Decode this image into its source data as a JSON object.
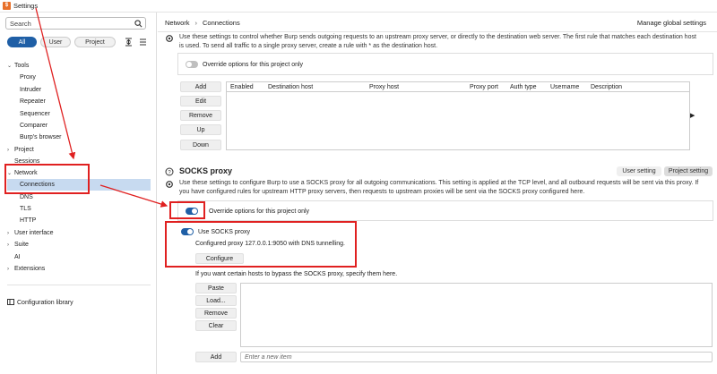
{
  "window": {
    "title": "Settings"
  },
  "sidebar": {
    "search_placeholder": "Search",
    "filters": {
      "all": "All",
      "user": "User",
      "project": "Project"
    },
    "tree": {
      "tools": "Tools",
      "proxy": "Proxy",
      "intruder": "Intruder",
      "repeater": "Repeater",
      "sequencer": "Sequencer",
      "comparer": "Comparer",
      "burps_browser": "Burp's browser",
      "project": "Project",
      "sessions": "Sessions",
      "network": "Network",
      "connections": "Connections",
      "dns": "DNS",
      "tls": "TLS",
      "http": "HTTP",
      "user_interface": "User interface",
      "suite": "Suite",
      "ai": "AI",
      "extensions": "Extensions",
      "config_library": "Configuration library"
    }
  },
  "header": {
    "breadcrumb": [
      "Network",
      "Connections"
    ],
    "manage": "Manage global settings"
  },
  "upstream": {
    "desc1": "Use these settings to control whether Burp sends outgoing requests to an upstream proxy server, or directly to the destination web server. The first rule that matches each destination host",
    "desc2": "is used. To send all traffic to a single proxy server, create a rule with * as the destination host.",
    "override": "Override options for this project only",
    "buttons": {
      "add": "Add",
      "edit": "Edit",
      "remove": "Remove",
      "up": "Up",
      "down": "Down"
    },
    "columns": [
      "Enabled",
      "Destination host",
      "Proxy host",
      "Proxy port",
      "Auth type",
      "Username",
      "Description"
    ]
  },
  "socks": {
    "title": "SOCKS proxy",
    "tag_user": "User setting",
    "tag_project": "Project setting",
    "desc1": "Use these settings to configure Burp to use a SOCKS proxy for all outgoing communications. This setting is applied at the TCP level, and all outbound requests will be sent via this proxy. If",
    "desc2": "you have configured rules for upstream HTTP proxy servers, then requests to upstream proxies will be sent via the SOCKS proxy configured here.",
    "override": "Override options for this project only",
    "use_socks": "Use SOCKS proxy",
    "configured": "Configured proxy 127.0.0.1:9050 with DNS tunnelling.",
    "configure": "Configure",
    "bypass_desc": "If you want certain hosts to bypass the SOCKS proxy, specify them here.",
    "buttons": {
      "paste": "Paste",
      "load": "Load...",
      "remove": "Remove",
      "clear": "Clear",
      "add": "Add"
    },
    "new_item_placeholder": "Enter a new item"
  },
  "colors": {
    "accent": "#1f5fa6",
    "annotation": "#e02020",
    "selected": "#c7daf0"
  }
}
